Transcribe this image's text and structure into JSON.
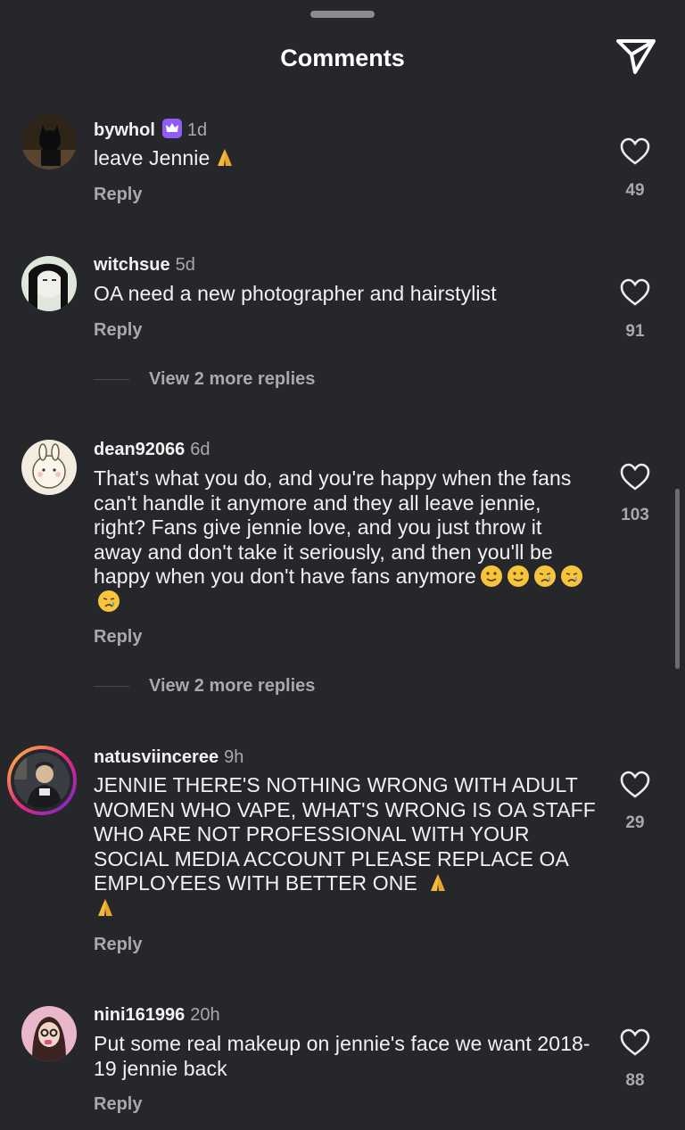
{
  "header": {
    "title": "Comments",
    "share_icon": "paper-plane-icon"
  },
  "comments": [
    {
      "username": "bywhol",
      "badge": "crown-icon",
      "time": "1d",
      "text": "leave Jennie",
      "emoji": [
        "folded-hands"
      ],
      "reply_label": "Reply",
      "likes": "49",
      "view_more": ""
    },
    {
      "username": "witchsue",
      "time": "5d",
      "text": "OA need a new photographer and hairstylist",
      "emoji": [],
      "reply_label": "Reply",
      "likes": "91",
      "view_more": "View 2 more replies"
    },
    {
      "username": "dean92066",
      "time": "6d",
      "text": "That's what you do, and you're happy when the fans can't handle it anymore and they all leave jennie, right? Fans give jennie love, and you just throw it away and don't take it seriously, and then you'll be happy when you don't have fans anymore",
      "emoji": [
        "slight-smile",
        "slight-smile",
        "crying",
        "crying",
        "crying"
      ],
      "reply_label": "Reply",
      "likes": "103",
      "view_more": "View 2 more replies"
    },
    {
      "username": "natusviinceree",
      "time": "9h",
      "text": "JENNIE THERE'S NOTHING WRONG WITH ADULT WOMEN WHO VAPE, WHAT'S WRONG IS OA STAFF WHO ARE NOT PROFESSIONAL WITH YOUR SOCIAL MEDIA ACCOUNT PLEASE REPLACE OA EMPLOYEES WITH BETTER ONE",
      "emoji": [
        "folded-hands",
        "folded-hands"
      ],
      "reply_label": "Reply",
      "likes": "29",
      "view_more": ""
    },
    {
      "username": "nini161996",
      "time": "20h",
      "text": "Put some real makeup on jennie's face we want 2018-19 jennie back",
      "emoji": [],
      "reply_label": "Reply",
      "likes": "88",
      "view_more": ""
    }
  ],
  "colors": {
    "background": "#26272b",
    "text": "#f2f2f2",
    "muted": "#a8a8ad",
    "badge": "#8f5cf5"
  }
}
